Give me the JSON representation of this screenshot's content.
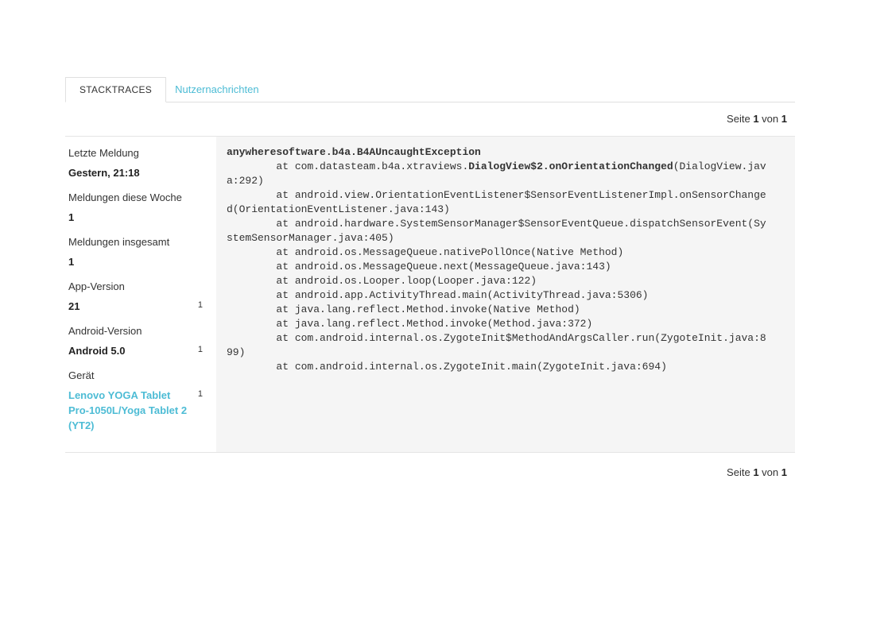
{
  "colors": {
    "accent": "#4dbcd5",
    "panel_bg": "#f5f5f5",
    "border": "#e0e0e0",
    "text": "#333333"
  },
  "tabs": [
    {
      "label": "STACKTRACES",
      "active": true
    },
    {
      "label": "Nutzernachrichten",
      "active": false
    }
  ],
  "pagination": {
    "label": "Seite",
    "page": "1",
    "of": "von",
    "total": "1"
  },
  "sidebar": {
    "stats": [
      {
        "label": "Letzte Meldung",
        "value": "Gestern, 21:18",
        "count": null,
        "link": false
      },
      {
        "label": "Meldungen diese Woche",
        "value": "1",
        "count": null,
        "link": false
      },
      {
        "label": "Meldungen insgesamt",
        "value": "1",
        "count": null,
        "link": false
      },
      {
        "label": "App-Version",
        "value": "21",
        "count": "1",
        "link": false
      },
      {
        "label": "Android-Version",
        "value": "Android 5.0",
        "count": "1",
        "link": false
      },
      {
        "label": "Gerät",
        "value": "Lenovo YOGA Tablet Pro-1050L/Yoga Tablet 2 (YT2)",
        "count": "1",
        "link": true
      }
    ]
  },
  "stacktrace": {
    "lines": [
      {
        "segments": [
          {
            "text": "anywheresoftware.b4a.B4AUncaughtException",
            "bold": true
          }
        ]
      },
      {
        "segments": [
          {
            "text": "        at com.datasteam.b4a.xtraviews.",
            "bold": false
          },
          {
            "text": "DialogView$2.onOrientationChanged",
            "bold": true
          },
          {
            "text": "(DialogView.jav",
            "bold": false
          }
        ]
      },
      {
        "segments": [
          {
            "text": "a:292)",
            "bold": false
          }
        ]
      },
      {
        "segments": [
          {
            "text": "        at android.view.OrientationEventListener$SensorEventListenerImpl.onSensorChange",
            "bold": false
          }
        ]
      },
      {
        "segments": [
          {
            "text": "d(OrientationEventListener.java:143)",
            "bold": false
          }
        ]
      },
      {
        "segments": [
          {
            "text": "        at android.hardware.SystemSensorManager$SensorEventQueue.dispatchSensorEvent(Sy",
            "bold": false
          }
        ]
      },
      {
        "segments": [
          {
            "text": "stemSensorManager.java:405)",
            "bold": false
          }
        ]
      },
      {
        "segments": [
          {
            "text": "        at android.os.MessageQueue.nativePollOnce(Native Method)",
            "bold": false
          }
        ]
      },
      {
        "segments": [
          {
            "text": "        at android.os.MessageQueue.next(MessageQueue.java:143)",
            "bold": false
          }
        ]
      },
      {
        "segments": [
          {
            "text": "        at android.os.Looper.loop(Looper.java:122)",
            "bold": false
          }
        ]
      },
      {
        "segments": [
          {
            "text": "        at android.app.ActivityThread.main(ActivityThread.java:5306)",
            "bold": false
          }
        ]
      },
      {
        "segments": [
          {
            "text": "        at java.lang.reflect.Method.invoke(Native Method)",
            "bold": false
          }
        ]
      },
      {
        "segments": [
          {
            "text": "        at java.lang.reflect.Method.invoke(Method.java:372)",
            "bold": false
          }
        ]
      },
      {
        "segments": [
          {
            "text": "        at com.android.internal.os.ZygoteInit$MethodAndArgsCaller.run(ZygoteInit.java:8",
            "bold": false
          }
        ]
      },
      {
        "segments": [
          {
            "text": "99)",
            "bold": false
          }
        ]
      },
      {
        "segments": [
          {
            "text": "        at com.android.internal.os.ZygoteInit.main(ZygoteInit.java:694)",
            "bold": false
          }
        ]
      }
    ]
  }
}
